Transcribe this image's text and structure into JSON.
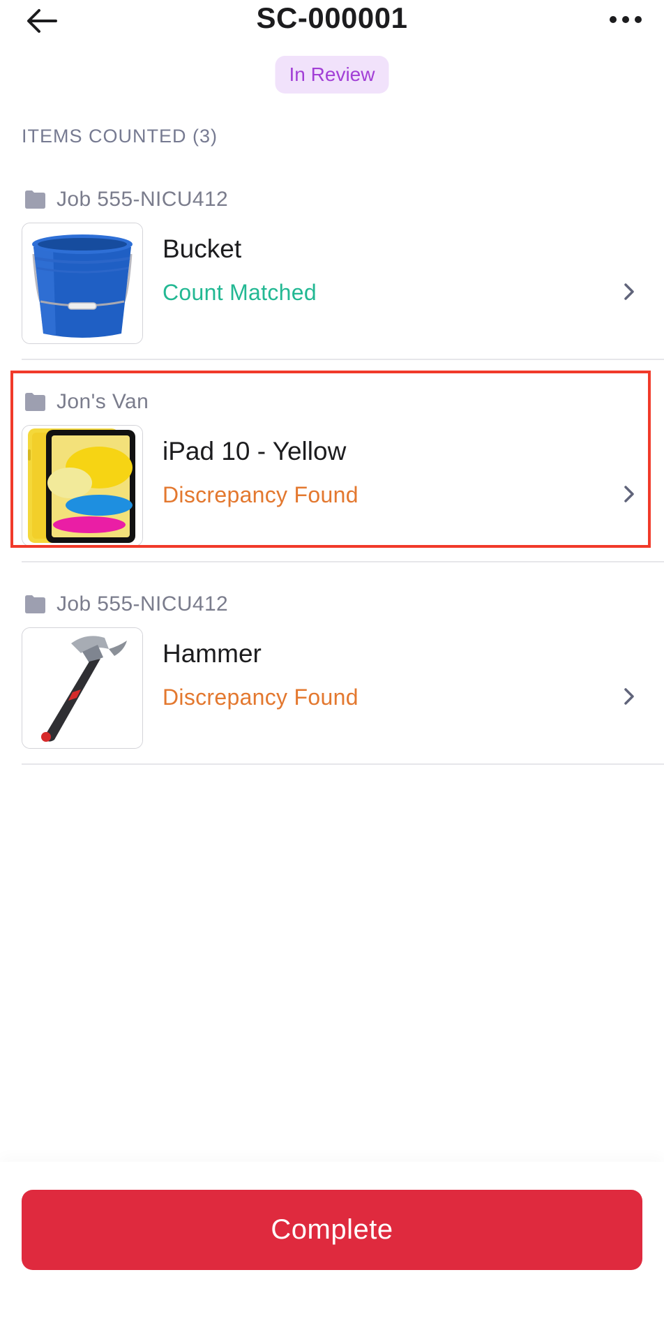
{
  "header": {
    "title": "SC-000001",
    "back_icon": "arrow-left-icon",
    "more_icon": "more-horizontal-icon"
  },
  "status_badge": {
    "label": "In Review",
    "color": "#a23fd6",
    "background": "#f1e2fb"
  },
  "section": {
    "title": "ITEMS COUNTED (3)"
  },
  "items": [
    {
      "location": "Job 555-NICU412",
      "name": "Bucket",
      "status": "Count Matched",
      "status_color": "#23b893",
      "thumbnail": "bucket"
    },
    {
      "location": "Jon's Van",
      "name": "iPad 10 - Yellow",
      "status": "Discrepancy Found",
      "status_color": "#e3782f",
      "thumbnail": "ipad"
    },
    {
      "location": "Job 555-NICU412",
      "name": "Hammer",
      "status": "Discrepancy Found",
      "status_color": "#e3782f",
      "thumbnail": "hammer"
    }
  ],
  "footer": {
    "complete_label": "Complete",
    "button_color": "#df2a3e"
  }
}
